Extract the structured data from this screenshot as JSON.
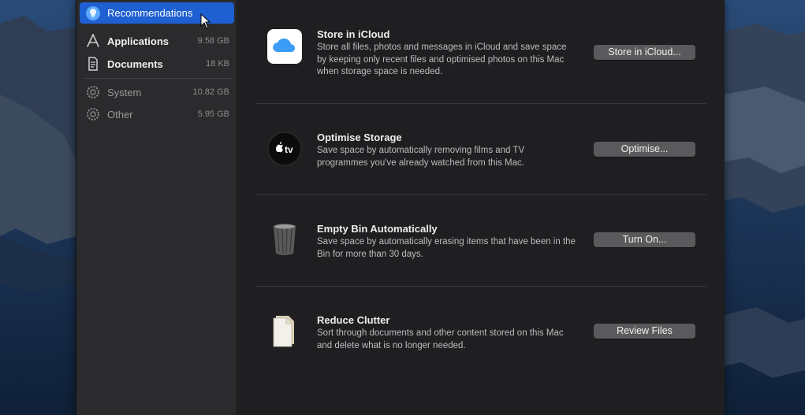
{
  "sidebar": {
    "items": [
      {
        "label": "Recommendations",
        "size": "",
        "icon": "lightbulb-icon",
        "selected": true
      },
      {
        "label": "Applications",
        "size": "9.58 GB",
        "icon": "applications-icon"
      },
      {
        "label": "Documents",
        "size": "18 KB",
        "icon": "document-icon"
      },
      {
        "label": "System",
        "size": "10.82 GB",
        "icon": "gear-icon"
      },
      {
        "label": "Other",
        "size": "5.95 GB",
        "icon": "gear-icon"
      }
    ]
  },
  "recommendations": [
    {
      "title": "Store in iCloud",
      "description": "Store all files, photos and messages in iCloud and save space by keeping only recent files and optimised photos on this Mac when storage space is needed.",
      "button": "Store in iCloud...",
      "icon": "icloud-icon"
    },
    {
      "title": "Optimise Storage",
      "description": "Save space by automatically removing films and TV programmes you've already watched from this Mac.",
      "button": "Optimise...",
      "icon": "apple-tv-icon"
    },
    {
      "title": "Empty Bin Automatically",
      "description": "Save space by automatically erasing items that have been in the Bin for more than 30 days.",
      "button": "Turn On...",
      "icon": "trash-bin-icon"
    },
    {
      "title": "Reduce Clutter",
      "description": "Sort through documents and other content stored on this Mac and delete what is no longer needed.",
      "button": "Review Files",
      "icon": "document-icon"
    }
  ],
  "icons": {
    "apple_tv_text": "tv"
  },
  "colors": {
    "accent": "#1e5fd1",
    "sidebar_bg": "#2b2b2d",
    "content_bg": "#1f1f21",
    "button_bg": "#5a5a5c"
  }
}
